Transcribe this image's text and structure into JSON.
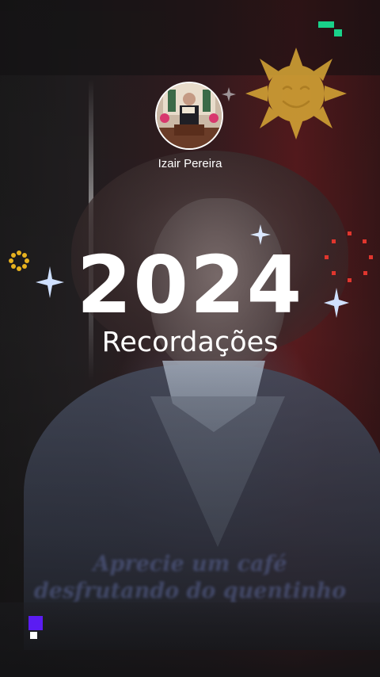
{
  "profile": {
    "username": "Izair Pereira"
  },
  "title": {
    "year": "2024",
    "subtitle": "Recordações"
  },
  "caption": {
    "line1": "Aprecie um café",
    "line2": "desfrutando do quentinho"
  },
  "colors": {
    "text": "#ffffff",
    "sun": "#e2b13a",
    "sparkle": "#dbe8ff",
    "dots_red": "#e0362e",
    "ring_yellow": "#e7b21f",
    "logo_green": "#19d28a",
    "badge_purple": "#5b1cf2"
  },
  "icons": {
    "top_right": "logo-icon",
    "bottom_left": "app-badge-icon",
    "sun": "smiling-sun-icon",
    "sparkles": "sparkle-icon",
    "ring": "dotted-ring-icon"
  }
}
